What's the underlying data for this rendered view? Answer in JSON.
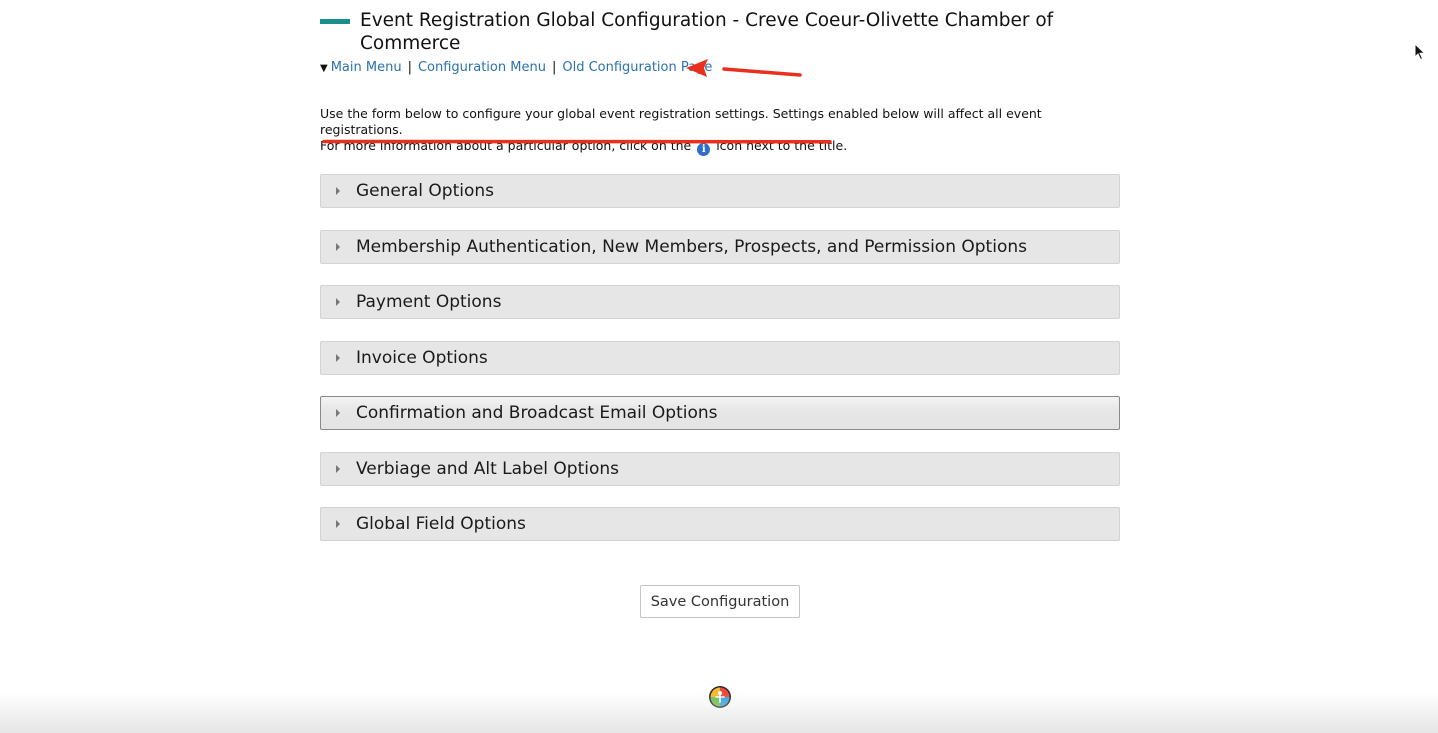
{
  "header": {
    "title": "Event Registration Global Configuration - Creve Coeur-Olivette Chamber of Commerce"
  },
  "nav": {
    "toggle_glyph": "▼",
    "separator": "|",
    "main_menu": "Main Menu",
    "configuration_menu": "Configuration Menu",
    "old_configuration_page": "Old Configuration Page"
  },
  "intro": {
    "line1": "Use the form below to configure your global event registration settings. Settings enabled below will affect all event registrations.",
    "line2_before": "For more information about a particular option, click on the",
    "info_glyph": "i",
    "line2_after": "icon next to the title."
  },
  "sections": [
    {
      "label": "General Options",
      "active": false
    },
    {
      "label": "Membership Authentication, New Members, Prospects, and Permission Options",
      "active": false
    },
    {
      "label": "Payment Options",
      "active": false
    },
    {
      "label": "Invoice Options",
      "active": false
    },
    {
      "label": "Confirmation and Broadcast Email Options",
      "active": true
    },
    {
      "label": "Verbiage and Alt Label Options",
      "active": false
    },
    {
      "label": "Global Field Options",
      "active": false
    }
  ],
  "actions": {
    "save_label": "Save Configuration"
  },
  "colors": {
    "accent_bar": "#1a8e8a",
    "link": "#2b72ad",
    "annotation": "#e8301c",
    "info_icon": "#2f6fcb"
  }
}
